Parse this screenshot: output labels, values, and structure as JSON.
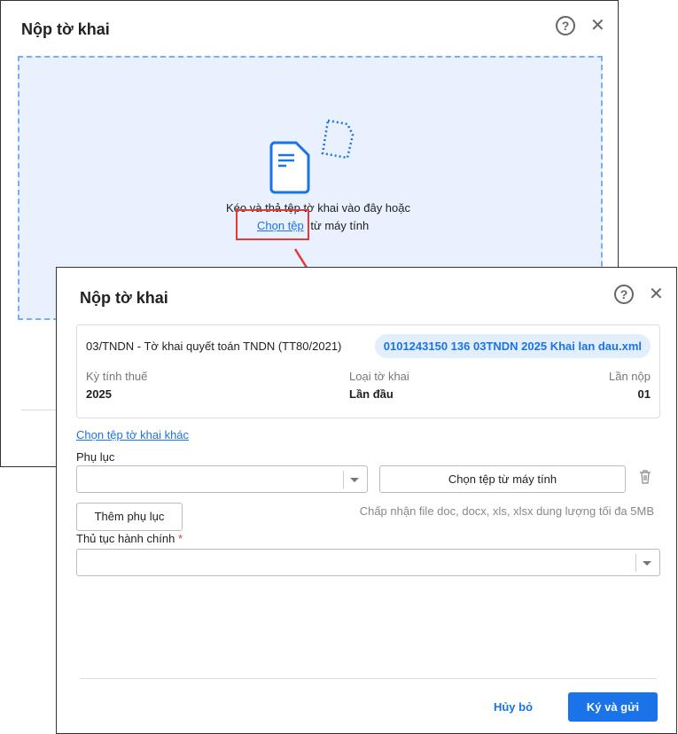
{
  "back_dialog": {
    "title": "Nộp tờ khai",
    "drop_text": "Kéo và thả tệp tờ khai vào đây hoặc",
    "choose_link": "Chọn tệp",
    "choose_suffix": "từ máy tính"
  },
  "front_dialog": {
    "title": "Nộp tờ khai",
    "help": "?",
    "close": "✕",
    "form_name": "03/TNDN - Tờ khai quyết toán TNDN (TT80/2021)",
    "file_name": "0101243150 136 03TNDN 2025 Khai lan dau.xml",
    "period_label": "Kỳ tính thuế",
    "period_value": "2025",
    "type_label": "Loại tờ khai",
    "type_value": "Lần đầu",
    "times_label": "Lần nộp",
    "times_value": "01",
    "choose_other": "Chọn tệp tờ khai khác",
    "appendix_label": "Phụ lục",
    "choose_file_btn": "Chọn tệp từ máy tính",
    "add_appendix_btn": "Thêm phụ lục",
    "accept_note": "Chấp nhận file doc, docx, xls, xlsx dung lượng tối đa 5MB",
    "procedure_label": "Thủ tục hành chính",
    "required_mark": "*",
    "cancel_btn": "Hủy bỏ",
    "submit_btn": "Ký và gửi"
  },
  "colors": {
    "accent": "#1a73e8",
    "highlight": "#e53935"
  }
}
